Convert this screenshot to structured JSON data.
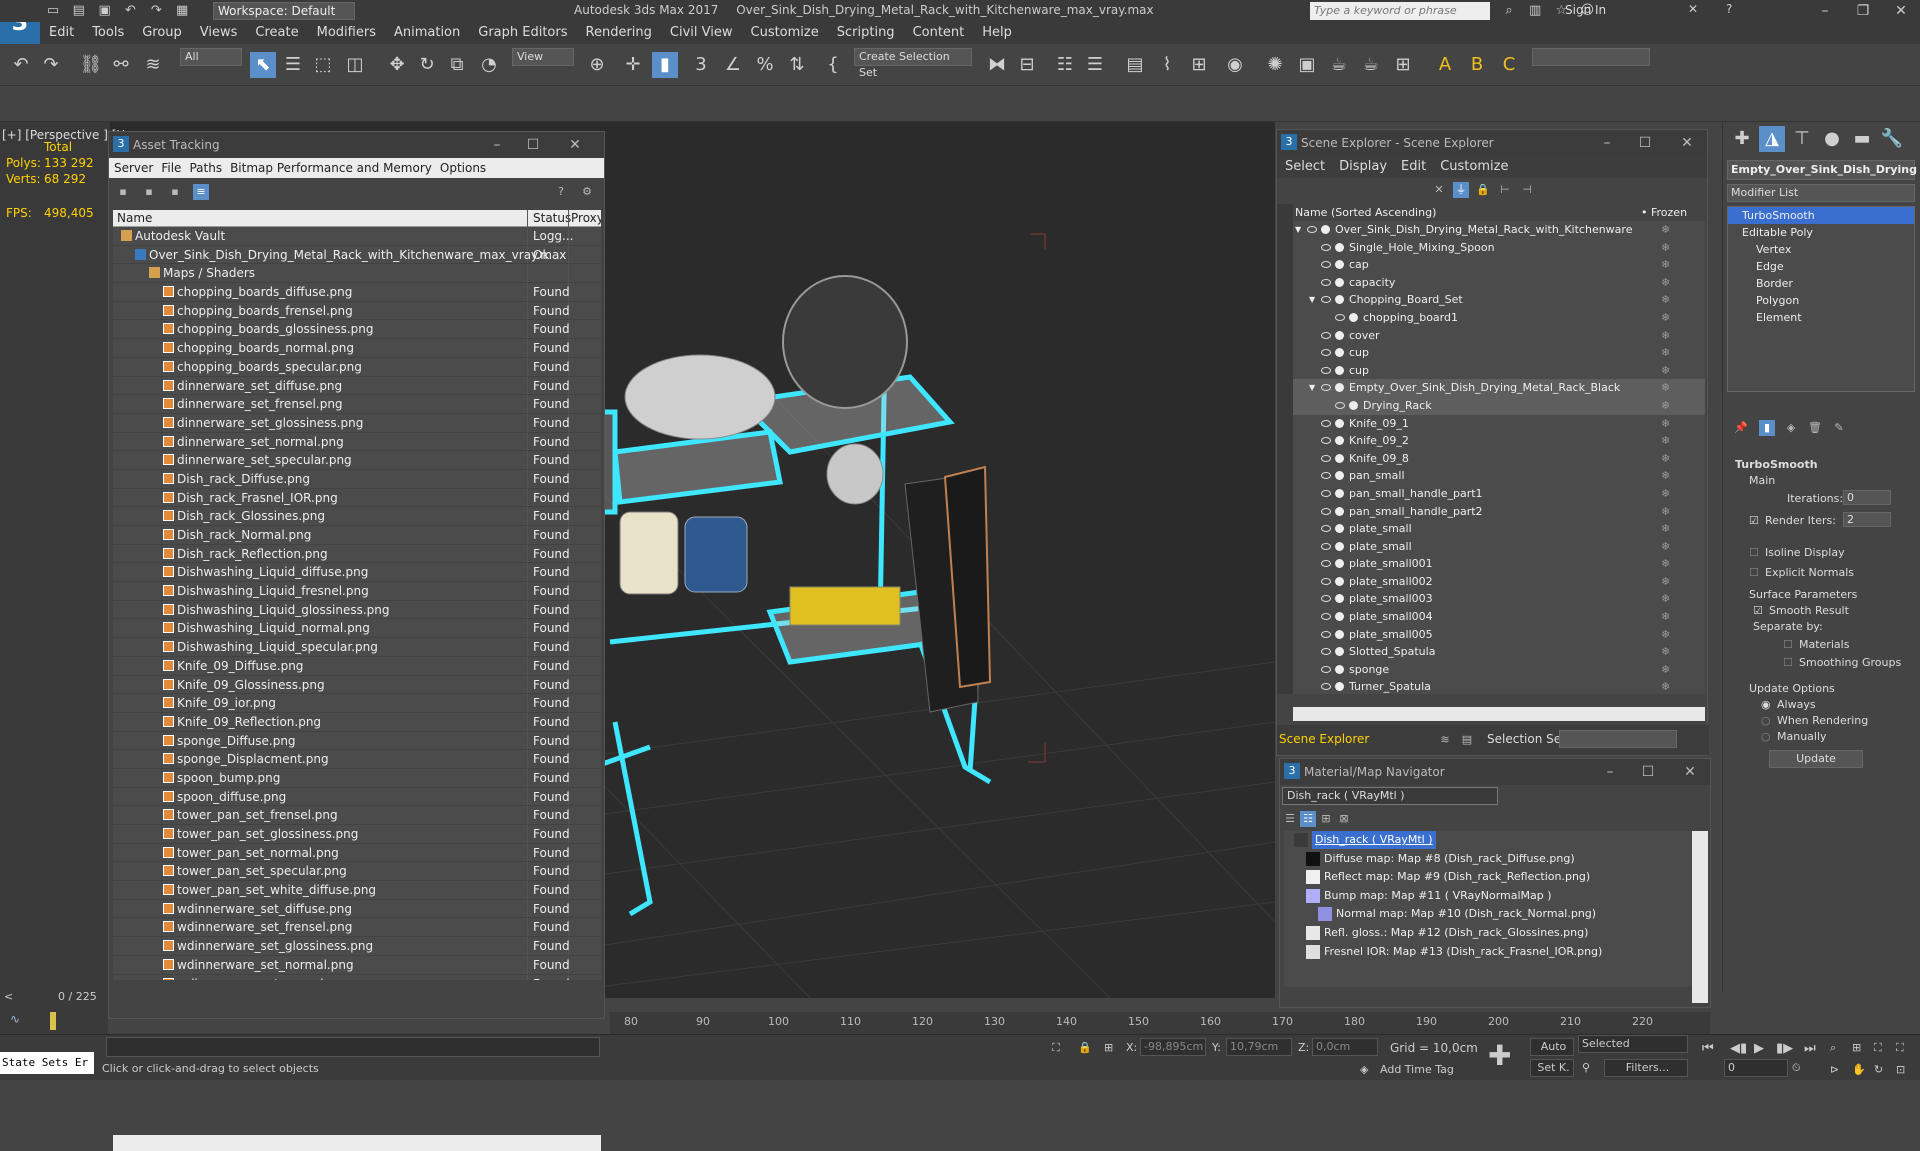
{
  "app": {
    "title": "Autodesk 3ds Max 2017",
    "file": "Over_Sink_Dish_Drying_Metal_Rack_with_Kitchenware_max_vray.max",
    "workspace": "Workspace: Default",
    "search_placeholder": "Type a keyword or phrase",
    "sign_in": "Sign In"
  },
  "menu": [
    "Edit",
    "Tools",
    "Group",
    "Views",
    "Create",
    "Modifiers",
    "Animation",
    "Graph Editors",
    "Rendering",
    "Civil View",
    "Customize",
    "Scripting",
    "Content",
    "Help"
  ],
  "toolbar": {
    "filter": "All",
    "view": "View",
    "selection_set": "Create Selection Set"
  },
  "viewport": {
    "label": "[+] [Perspective ] [U",
    "total": "Total",
    "polys_label": "Polys:",
    "polys": "133 292",
    "verts_label": "Verts:",
    "verts": "68 292",
    "fps_label": "FPS:",
    "fps": "498,405"
  },
  "asset_tracking": {
    "title": "Asset Tracking",
    "menu": [
      "Server",
      "File",
      "Paths",
      "Bitmap Performance and Memory",
      "Options"
    ],
    "columns": [
      "Name",
      "Status",
      "Proxy"
    ],
    "rows": [
      {
        "name": "Autodesk Vault",
        "status": "Logg...",
        "indent": 0,
        "type": "vault"
      },
      {
        "name": "Over_Sink_Dish_Drying_Metal_Rack_with_Kitchenware_max_vray.max",
        "status": "Ok",
        "indent": 1,
        "type": "max"
      },
      {
        "name": "Maps / Shaders",
        "status": "",
        "indent": 2,
        "type": "folder"
      },
      {
        "name": "chopping_boards_diffuse.png",
        "status": "Found",
        "indent": 3,
        "type": "file"
      },
      {
        "name": "chopping_boards_frensel.png",
        "status": "Found",
        "indent": 3,
        "type": "file"
      },
      {
        "name": "chopping_boards_glossiness.png",
        "status": "Found",
        "indent": 3,
        "type": "file"
      },
      {
        "name": "chopping_boards_normal.png",
        "status": "Found",
        "indent": 3,
        "type": "file"
      },
      {
        "name": "chopping_boards_specular.png",
        "status": "Found",
        "indent": 3,
        "type": "file"
      },
      {
        "name": "dinnerware_set_diffuse.png",
        "status": "Found",
        "indent": 3,
        "type": "file"
      },
      {
        "name": "dinnerware_set_frensel.png",
        "status": "Found",
        "indent": 3,
        "type": "file"
      },
      {
        "name": "dinnerware_set_glossiness.png",
        "status": "Found",
        "indent": 3,
        "type": "file"
      },
      {
        "name": "dinnerware_set_normal.png",
        "status": "Found",
        "indent": 3,
        "type": "file"
      },
      {
        "name": "dinnerware_set_specular.png",
        "status": "Found",
        "indent": 3,
        "type": "file"
      },
      {
        "name": "Dish_rack_Diffuse.png",
        "status": "Found",
        "indent": 3,
        "type": "file"
      },
      {
        "name": "Dish_rack_Frasnel_IOR.png",
        "status": "Found",
        "indent": 3,
        "type": "file"
      },
      {
        "name": "Dish_rack_Glossines.png",
        "status": "Found",
        "indent": 3,
        "type": "file"
      },
      {
        "name": "Dish_rack_Normal.png",
        "status": "Found",
        "indent": 3,
        "type": "file"
      },
      {
        "name": "Dish_rack_Reflection.png",
        "status": "Found",
        "indent": 3,
        "type": "file"
      },
      {
        "name": "Dishwashing_Liquid_diffuse.png",
        "status": "Found",
        "indent": 3,
        "type": "file"
      },
      {
        "name": "Dishwashing_Liquid_fresnel.png",
        "status": "Found",
        "indent": 3,
        "type": "file"
      },
      {
        "name": "Dishwashing_Liquid_glossiness.png",
        "status": "Found",
        "indent": 3,
        "type": "file"
      },
      {
        "name": "Dishwashing_Liquid_normal.png",
        "status": "Found",
        "indent": 3,
        "type": "file"
      },
      {
        "name": "Dishwashing_Liquid_specular.png",
        "status": "Found",
        "indent": 3,
        "type": "file"
      },
      {
        "name": "Knife_09_Diffuse.png",
        "status": "Found",
        "indent": 3,
        "type": "file"
      },
      {
        "name": "Knife_09_Glossiness.png",
        "status": "Found",
        "indent": 3,
        "type": "file"
      },
      {
        "name": "Knife_09_ior.png",
        "status": "Found",
        "indent": 3,
        "type": "file"
      },
      {
        "name": "Knife_09_Reflection.png",
        "status": "Found",
        "indent": 3,
        "type": "file"
      },
      {
        "name": "sponge_Diffuse.png",
        "status": "Found",
        "indent": 3,
        "type": "file"
      },
      {
        "name": "sponge_Displacment.png",
        "status": "Found",
        "indent": 3,
        "type": "file"
      },
      {
        "name": "spoon_bump.png",
        "status": "Found",
        "indent": 3,
        "type": "file"
      },
      {
        "name": "spoon_diffuse.png",
        "status": "Found",
        "indent": 3,
        "type": "file"
      },
      {
        "name": "tower_pan_set_frensel.png",
        "status": "Found",
        "indent": 3,
        "type": "file"
      },
      {
        "name": "tower_pan_set_glossiness.png",
        "status": "Found",
        "indent": 3,
        "type": "file"
      },
      {
        "name": "tower_pan_set_normal.png",
        "status": "Found",
        "indent": 3,
        "type": "file"
      },
      {
        "name": "tower_pan_set_specular.png",
        "status": "Found",
        "indent": 3,
        "type": "file"
      },
      {
        "name": "tower_pan_set_white_diffuse.png",
        "status": "Found",
        "indent": 3,
        "type": "file"
      },
      {
        "name": "wdinnerware_set_diffuse.png",
        "status": "Found",
        "indent": 3,
        "type": "file"
      },
      {
        "name": "wdinnerware_set_frensel.png",
        "status": "Found",
        "indent": 3,
        "type": "file"
      },
      {
        "name": "wdinnerware_set_glossiness.png",
        "status": "Found",
        "indent": 3,
        "type": "file"
      },
      {
        "name": "wdinnerware_set_normal.png",
        "status": "Found",
        "indent": 3,
        "type": "file"
      },
      {
        "name": "wdinnerware_set_specular.png",
        "status": "Found",
        "indent": 3,
        "type": "file"
      }
    ]
  },
  "scene_explorer": {
    "title": "Scene Explorer - Scene Explorer",
    "menu": [
      "Select",
      "Display",
      "Edit",
      "Customize"
    ],
    "col_name": "Name (Sorted Ascending)",
    "col_frozen": "• Frozen",
    "footer_label": "Scene Explorer",
    "selection_set_label": "Selection Set:",
    "rows": [
      {
        "name": "Over_Sink_Dish_Drying_Metal_Rack_with_Kitchenware",
        "level": 0,
        "expand": true,
        "selected": false
      },
      {
        "name": "Single_Hole_Mixing_Spoon",
        "level": 1,
        "expand": false,
        "selected": false
      },
      {
        "name": "cap",
        "level": 1,
        "expand": false,
        "selected": false
      },
      {
        "name": "capacity",
        "level": 1,
        "expand": false,
        "selected": false
      },
      {
        "name": "Chopping_Board_Set",
        "level": 1,
        "expand": true,
        "selected": false
      },
      {
        "name": "chopping_board1",
        "level": 2,
        "expand": false,
        "selected": false
      },
      {
        "name": "cover",
        "level": 1,
        "expand": false,
        "selected": false
      },
      {
        "name": "cup",
        "level": 1,
        "expand": false,
        "selected": false
      },
      {
        "name": "cup",
        "level": 1,
        "expand": false,
        "selected": false
      },
      {
        "name": "Empty_Over_Sink_Dish_Drying_Metal_Rack_Black",
        "level": 1,
        "expand": true,
        "selected": true
      },
      {
        "name": "Drying_Rack",
        "level": 2,
        "expand": false,
        "selected": true
      },
      {
        "name": "Knife_09_1",
        "level": 1,
        "expand": false,
        "selected": false
      },
      {
        "name": "Knife_09_2",
        "level": 1,
        "expand": false,
        "selected": false
      },
      {
        "name": "Knife_09_8",
        "level": 1,
        "expand": false,
        "selected": false
      },
      {
        "name": "pan_small",
        "level": 1,
        "expand": false,
        "selected": false
      },
      {
        "name": "pan_small_handle_part1",
        "level": 1,
        "expand": false,
        "selected": false
      },
      {
        "name": "pan_small_handle_part2",
        "level": 1,
        "expand": false,
        "selected": false
      },
      {
        "name": "plate_small",
        "level": 1,
        "expand": false,
        "selected": false
      },
      {
        "name": "plate_small",
        "level": 1,
        "expand": false,
        "selected": false
      },
      {
        "name": "plate_small001",
        "level": 1,
        "expand": false,
        "selected": false
      },
      {
        "name": "plate_small002",
        "level": 1,
        "expand": false,
        "selected": false
      },
      {
        "name": "plate_small003",
        "level": 1,
        "expand": false,
        "selected": false
      },
      {
        "name": "plate_small004",
        "level": 1,
        "expand": false,
        "selected": false
      },
      {
        "name": "plate_small005",
        "level": 1,
        "expand": false,
        "selected": false
      },
      {
        "name": "Slotted_Spatula",
        "level": 1,
        "expand": false,
        "selected": false
      },
      {
        "name": "sponge",
        "level": 1,
        "expand": false,
        "selected": false
      },
      {
        "name": "Turner_Spatula",
        "level": 1,
        "expand": false,
        "selected": false
      }
    ]
  },
  "material_navigator": {
    "title": "Material/Map Navigator",
    "field": "Dish_rack  ( VRayMtl )",
    "rows": [
      {
        "text": "Dish_rack  ( VRayMtl )",
        "swatch": "#3a3a3a",
        "selected": true,
        "indent": 0
      },
      {
        "text": "Diffuse map: Map #8 (Dish_rack_Diffuse.png)",
        "swatch": "#111111",
        "selected": false,
        "indent": 1
      },
      {
        "text": "Reflect map: Map #9 (Dish_rack_Reflection.png)",
        "swatch": "#f0f0f0",
        "selected": false,
        "indent": 1
      },
      {
        "text": "Bump map: Map #11  ( VRayNormalMap )",
        "swatch": "#b0b0ff",
        "selected": false,
        "indent": 1
      },
      {
        "text": "Normal map: Map #10 (Dish_rack_Normal.png)",
        "swatch": "#9090e0",
        "selected": false,
        "indent": 2
      },
      {
        "text": "Refl. gloss.: Map #12 (Dish_rack_Glossines.png)",
        "swatch": "#e8e8e8",
        "selected": false,
        "indent": 1
      },
      {
        "text": "Fresnel IOR: Map #13 (Dish_rack_Frasnel_IOR.png)",
        "swatch": "#e0e0e0",
        "selected": false,
        "indent": 1
      }
    ]
  },
  "command_panel": {
    "object_name": "Empty_Over_Sink_Dish_Drying",
    "modifier_list": "Modifier List",
    "stack": [
      "TurboSmooth",
      "Editable Poly",
      "Vertex",
      "Edge",
      "Border",
      "Polygon",
      "Element"
    ],
    "rollout": "TurboSmooth",
    "main": "Main",
    "iterations_label": "Iterations:",
    "iterations": "0",
    "render_iters_label": "Render Iters:",
    "render_iters": "2",
    "isoline": "Isoline Display",
    "explicit_normals": "Explicit Normals",
    "surface_params": "Surface Parameters",
    "smooth_result": "Smooth Result",
    "separate_by": "Separate by:",
    "materials": "Materials",
    "smoothing_groups": "Smoothing Groups",
    "update_options": "Update Options",
    "always": "Always",
    "when_rendering": "When Rendering",
    "manually": "Manually",
    "update_button": "Update"
  },
  "timeline": {
    "frame": "0 / 225",
    "ticks": [
      "80",
      "90",
      "100",
      "110",
      "120",
      "130",
      "140",
      "150",
      "160",
      "170",
      "180",
      "190",
      "200",
      "210",
      "220"
    ]
  },
  "status": {
    "listener": "State Sets Er",
    "prompt": "Click or click-and-drag to select objects",
    "x_label": "X:",
    "x": "-98,895cm",
    "y_label": "Y:",
    "y": "10,79cm",
    "z_label": "Z:",
    "z": "0,0cm",
    "grid": "Grid = 10,0cm",
    "add_time_tag": "Add Time Tag",
    "auto": "Auto",
    "set_k": "Set K.",
    "selected": "Selected",
    "filters": "Filters...",
    "frame_field": "0"
  }
}
